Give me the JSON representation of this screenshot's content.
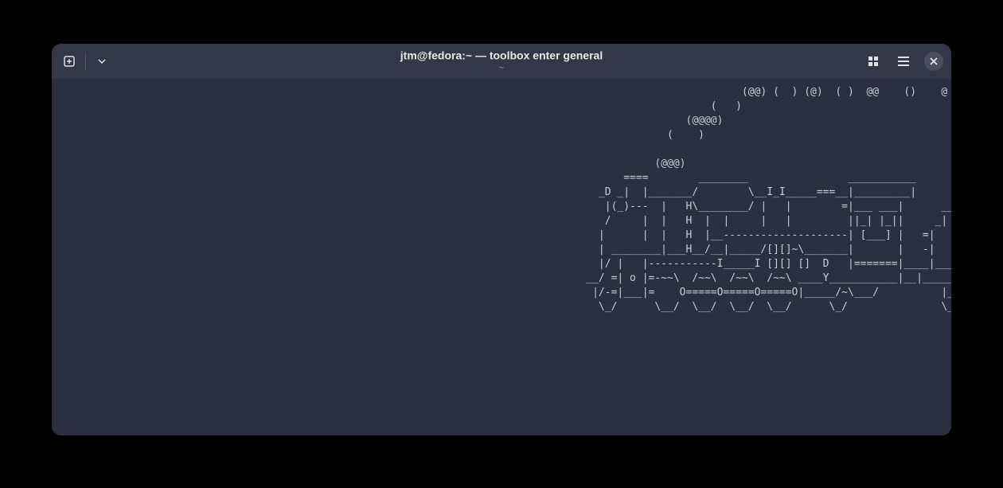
{
  "window": {
    "title": "jtm@fedora:~ — toolbox enter general",
    "subtitle": "~"
  },
  "icons": {
    "newtab": "new-tab",
    "dropdown": "dropdown",
    "grid": "grid",
    "menu": "menu",
    "close": "close"
  },
  "terminal": {
    "output": "                                                                                                              (@@) (  ) (@)  ( )  @@    ()    @     O\n                                                                                                         (   )\n                                                                                                     (@@@@)\n                                                                                                  (    )\n\n                                                                                                (@@@)\n                                                                                           ====        ________                ___________\n                                                                                       _D _|  |_______/        \\__I_I_____===__|_________|\n                                                                                        |(_)---  |   H\\________/ |   |        =|___ ___|      _____\n                                                                                        /     |  |   H  |  |     |   |         ||_| |_||     _|     \n                                                                                       |      |  |   H  |__--------------------| [___] |   =|      \n                                                                                       | ________|___H__/__|_____/[][]~\\_______|       |   -|      \n                                                                                       |/ |   |-----------I_____I [][] []  D   |=======|____|_____\n                                                                                     __/ =| o |=-~~\\  /~~\\  /~~\\  /~~\\ ____Y___________|__|_______\n                                                                                      |/-=|___|=    O=====O=====O=====O|_____/~\\___/          |_D__D_\n                                                                                       \\_/      \\__/  \\__/  \\__/  \\__/      \\_/               \\_/"
  }
}
